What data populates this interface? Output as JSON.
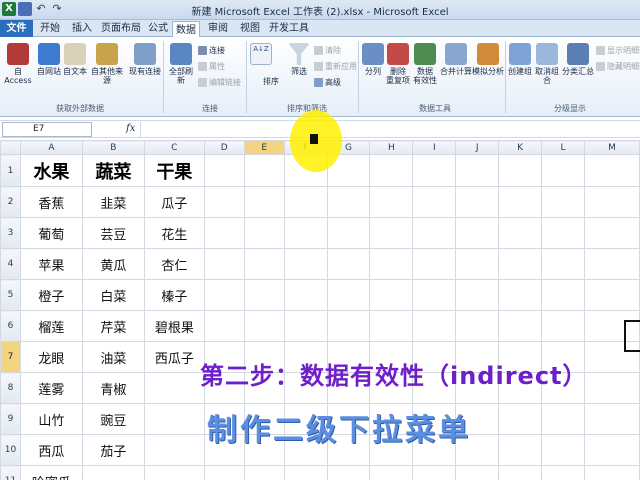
{
  "window": {
    "title": "新建 Microsoft Excel 工作表 (2).xlsx - Microsoft Excel",
    "app_icon": "X"
  },
  "tabs": [
    "文件",
    "开始",
    "插入",
    "页面布局",
    "公式",
    "数据",
    "审阅",
    "视图",
    "开发工具"
  ],
  "ribbon": {
    "ext_buttons": [
      "自 Access",
      "自网站",
      "自文本",
      "自其他来源",
      "现有连接"
    ],
    "refresh": "全部刷新",
    "conn_items": [
      "连接",
      "属性",
      "编辑链接"
    ],
    "sort_az": "A↓Z",
    "sort": "排序",
    "filter": "筛选",
    "filter_items": [
      "清除",
      "重新应用",
      "高级"
    ],
    "tools": [
      "分列",
      "删除\n重复项",
      "数据\n有效性",
      "合并计算",
      "模拟分析"
    ],
    "outline": [
      "创建组",
      "取消组合",
      "分类汇总"
    ],
    "outline_small": [
      "显示明细数据",
      "隐藏明细数据"
    ],
    "groups": [
      "获取外部数据",
      "连接",
      "排序和筛选",
      "数据工具",
      "分级显示"
    ]
  },
  "formula_bar": {
    "name_box": "E7",
    "fx": "fx",
    "formula": ""
  },
  "columns": [
    "A",
    "B",
    "C",
    "D",
    "E",
    "F",
    "G",
    "H",
    "I",
    "J",
    "K",
    "L",
    "M"
  ],
  "rows": [
    [
      "水果",
      "蔬菜",
      "干果"
    ],
    [
      "香蕉",
      "韭菜",
      "瓜子"
    ],
    [
      "葡萄",
      "芸豆",
      "花生"
    ],
    [
      "苹果",
      "黄瓜",
      "杏仁"
    ],
    [
      "橙子",
      "白菜",
      "榛子"
    ],
    [
      "榴莲",
      "芹菜",
      "碧根果"
    ],
    [
      "龙眼",
      "油菜",
      "西瓜子"
    ],
    [
      "莲雾",
      "青椒",
      ""
    ],
    [
      "山竹",
      "豌豆",
      ""
    ],
    [
      "西瓜",
      "茄子",
      ""
    ],
    [
      "哈密瓜",
      "",
      ""
    ]
  ],
  "row_numbers": [
    "1",
    "2",
    "3",
    "4",
    "5",
    "6",
    "7",
    "8",
    "9",
    "10",
    "11"
  ],
  "selected_row": 7,
  "overlay": {
    "step_text": "第二步：数据有效性（indirect）",
    "title_text": "制作二级下拉菜单"
  }
}
